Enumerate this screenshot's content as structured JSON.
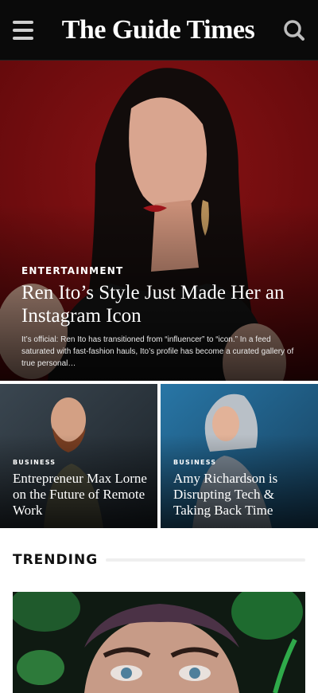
{
  "header": {
    "brand": "The Guide Times",
    "menu_icon": "hamburger-menu-icon",
    "search_icon": "search-icon"
  },
  "hero": {
    "category": "ENTERTAINMENT",
    "title": "Ren Ito’s Style Just Made Her an Instagram Icon",
    "excerpt": "It’s official: Ren Ito has transitioned from “influencer” to “icon.” In a feed saturated with fast-fashion hauls, Ito’s profile has become a curated gallery of true personal…"
  },
  "cards": [
    {
      "category": "BUSINESS",
      "title": "Entrepreneur Max Lorne on the Future of Remote Work"
    },
    {
      "category": "BUSINESS",
      "title": "Amy Richardson is Disrupting Tech & Taking Back Time"
    }
  ],
  "trending": {
    "title": "TRENDING"
  },
  "colors": {
    "header_bg": "#0a0a0a",
    "hero_bg": "#7a1012",
    "card1_bg": "#2c3740",
    "card2_bg": "#1c5a80"
  }
}
